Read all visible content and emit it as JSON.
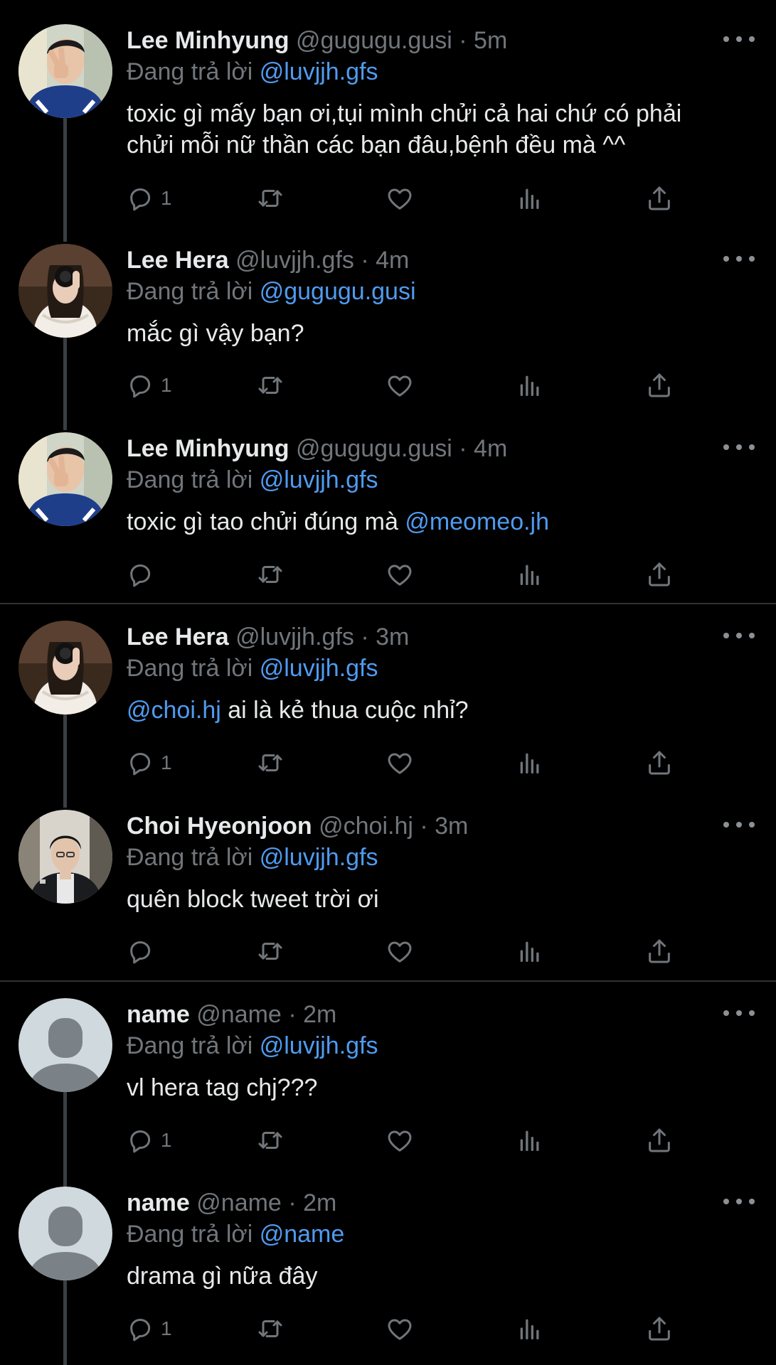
{
  "reply_prefix": "Đang trả lời",
  "colors": {
    "background": "#000000",
    "text": "#e7e9ea",
    "muted": "#71767b",
    "link": "#4f9bf0"
  },
  "tweets": [
    {
      "name": "Lee Minhyung",
      "handle": "@gugugu.gusi",
      "dot": "·",
      "time": "5m",
      "reply_to": "@luvjjh.gfs",
      "text_lines": [
        "toxic gì mấy bạn ơi,tụi mình chửi cả hai chứ có phải",
        "chửi mỗi nữ thần các bạn đâu,bệnh đều mà ^^"
      ],
      "reply_count": "1",
      "avatar": "photo-man-peace-sign"
    },
    {
      "name": "Lee Hera",
      "handle": "@luvjjh.gfs",
      "dot": "·",
      "time": "4m",
      "reply_to": "@gugugu.gusi",
      "text_lines": [
        "mắc gì vậy bạn?"
      ],
      "reply_count": "1",
      "avatar": "photo-woman-mirror"
    },
    {
      "name": "Lee Minhyung",
      "handle": "@gugugu.gusi",
      "dot": "·",
      "time": "4m",
      "reply_to": "@luvjjh.gfs",
      "text_pre": "toxic gì tao chửi đúng mà ",
      "text_mention": "@meomeo.jh",
      "reply_count": "",
      "avatar": "photo-man-peace-sign"
    },
    {
      "name": "Lee Hera",
      "handle": "@luvjjh.gfs",
      "dot": "·",
      "time": "3m",
      "reply_to": "@luvjjh.gfs",
      "text_mention_first": "@choi.hj",
      "text_post": " ai là kẻ thua cuộc nhỉ?",
      "reply_count": "1",
      "avatar": "photo-woman-mirror"
    },
    {
      "name": "Choi Hyeonjoon",
      "handle": "@choi.hj",
      "dot": "·",
      "time": "3m",
      "reply_to": "@luvjjh.gfs",
      "text_lines": [
        "quên block tweet trời ơi"
      ],
      "reply_count": "",
      "avatar": "photo-man-dark-jacket"
    },
    {
      "name": "name",
      "handle": "@name",
      "dot": "·",
      "time": "2m",
      "reply_to": "@luvjjh.gfs",
      "text_lines": [
        "vl hera tag chj???"
      ],
      "reply_count": "1",
      "avatar": "default-avatar"
    },
    {
      "name": "name",
      "handle": "@name",
      "dot": "·",
      "time": "2m",
      "reply_to": "@name",
      "text_lines": [
        "drama gì nữa đây"
      ],
      "reply_count": "1",
      "avatar": "default-avatar"
    }
  ]
}
